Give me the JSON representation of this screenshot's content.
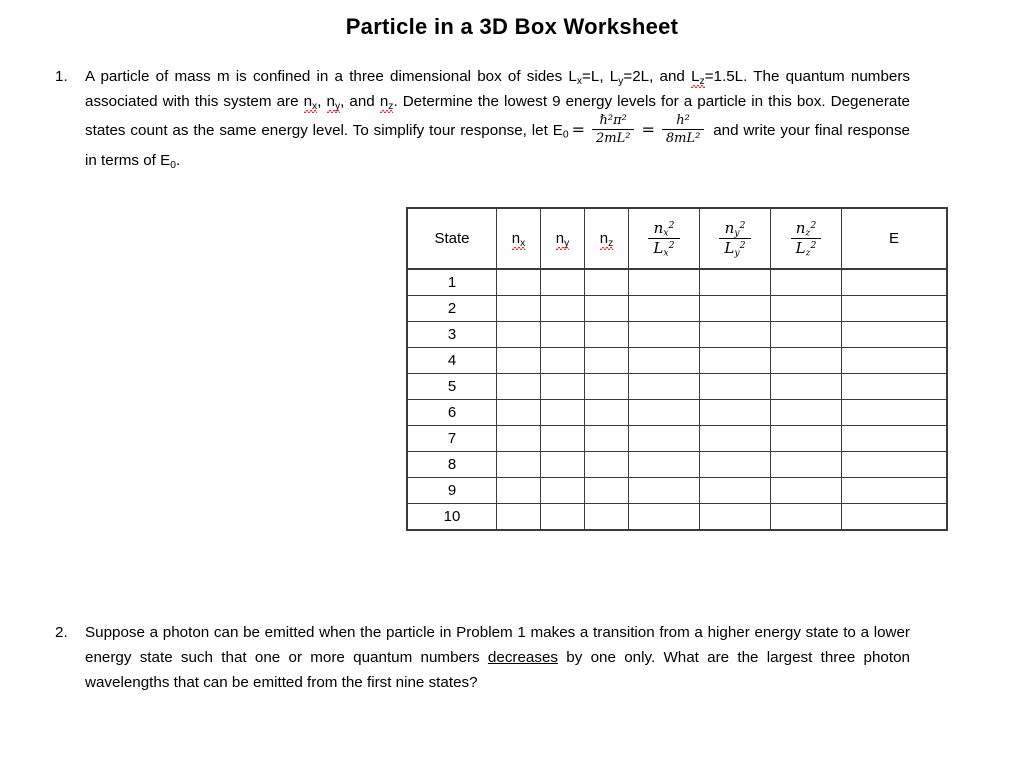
{
  "document": {
    "title": "Particle in a  3D Box Worksheet"
  },
  "problems": [
    {
      "number": "1.",
      "segments": {
        "s1": "A particle of mass m is confined in a three dimensional box of sides L",
        "sub_x1": "x",
        "s2": "=L, L",
        "sub_y1": "y",
        "s3": "=2L, and ",
        "lz_main": "L",
        "lz_sub": "z",
        "s4": "=1.5L. The quantum numbers associated with this system are ",
        "nx_main": "n",
        "nx_sub": "x",
        "comma1": ", ",
        "ny_main": "n",
        "ny_sub": "y",
        "comma2": ", and ",
        "nz_main": "n",
        "nz_sub": "z",
        "s5": ". Determine the lowest 9 energy levels for a particle in this box. Degenerate states count as the same energy level.  To simplify tour response, let E",
        "e0_sub": "0",
        "eq": "=",
        "frac1_num": "ℏ²π²",
        "frac1_den": "2mL²",
        "eq2": "=",
        "frac2_num": "h²",
        "frac2_den": "8mL²",
        "s6": "and write your final response in terms of E",
        "e0_sub2": "0",
        "s7": "."
      }
    },
    {
      "number": "2.",
      "segments": {
        "s1": "Suppose a photon can be emitted when the particle in Problem 1 makes a transition from a higher energy state to a lower energy state such that one or more quantum numbers ",
        "underlined": "decreases",
        "s2": " by one only.  What are the largest three photon wavelengths that can be emitted from the first nine states?"
      }
    }
  ],
  "table": {
    "headers": {
      "state": "State",
      "nx": {
        "base": "n",
        "sub": "x"
      },
      "ny": {
        "base": "n",
        "sub": "y"
      },
      "nz": {
        "base": "n",
        "sub": "z"
      },
      "fx": {
        "num_base": "n",
        "num_sub": "x",
        "num_sup": "2",
        "den_base": "L",
        "den_sub": "x",
        "den_sup": "2"
      },
      "fy": {
        "num_base": "n",
        "num_sub": "y",
        "num_sup": "2",
        "den_base": "L",
        "den_sub": "y",
        "den_sup": "2"
      },
      "fz": {
        "num_base": "n",
        "num_sub": "z",
        "num_sup": "2",
        "den_base": "L",
        "den_sub": "z",
        "den_sup": "2"
      },
      "energy": "E"
    },
    "rows": [
      {
        "state": "1",
        "nx": "",
        "ny": "",
        "nz": "",
        "fx": "",
        "fy": "",
        "fz": "",
        "energy": ""
      },
      {
        "state": "2",
        "nx": "",
        "ny": "",
        "nz": "",
        "fx": "",
        "fy": "",
        "fz": "",
        "energy": ""
      },
      {
        "state": "3",
        "nx": "",
        "ny": "",
        "nz": "",
        "fx": "",
        "fy": "",
        "fz": "",
        "energy": ""
      },
      {
        "state": "4",
        "nx": "",
        "ny": "",
        "nz": "",
        "fx": "",
        "fy": "",
        "fz": "",
        "energy": ""
      },
      {
        "state": "5",
        "nx": "",
        "ny": "",
        "nz": "",
        "fx": "",
        "fy": "",
        "fz": "",
        "energy": ""
      },
      {
        "state": "6",
        "nx": "",
        "ny": "",
        "nz": "",
        "fx": "",
        "fy": "",
        "fz": "",
        "energy": ""
      },
      {
        "state": "7",
        "nx": "",
        "ny": "",
        "nz": "",
        "fx": "",
        "fy": "",
        "fz": "",
        "energy": ""
      },
      {
        "state": "8",
        "nx": "",
        "ny": "",
        "nz": "",
        "fx": "",
        "fy": "",
        "fz": "",
        "energy": ""
      },
      {
        "state": "9",
        "nx": "",
        "ny": "",
        "nz": "",
        "fx": "",
        "fy": "",
        "fz": "",
        "energy": ""
      },
      {
        "state": "10",
        "nx": "",
        "ny": "",
        "nz": "",
        "fx": "",
        "fy": "",
        "fz": "",
        "energy": ""
      }
    ]
  },
  "colors": {
    "text": "#000000",
    "spellcheck_underline": "#e03030",
    "table_border": "#3b3b3b",
    "page_background": "#ffffff"
  }
}
